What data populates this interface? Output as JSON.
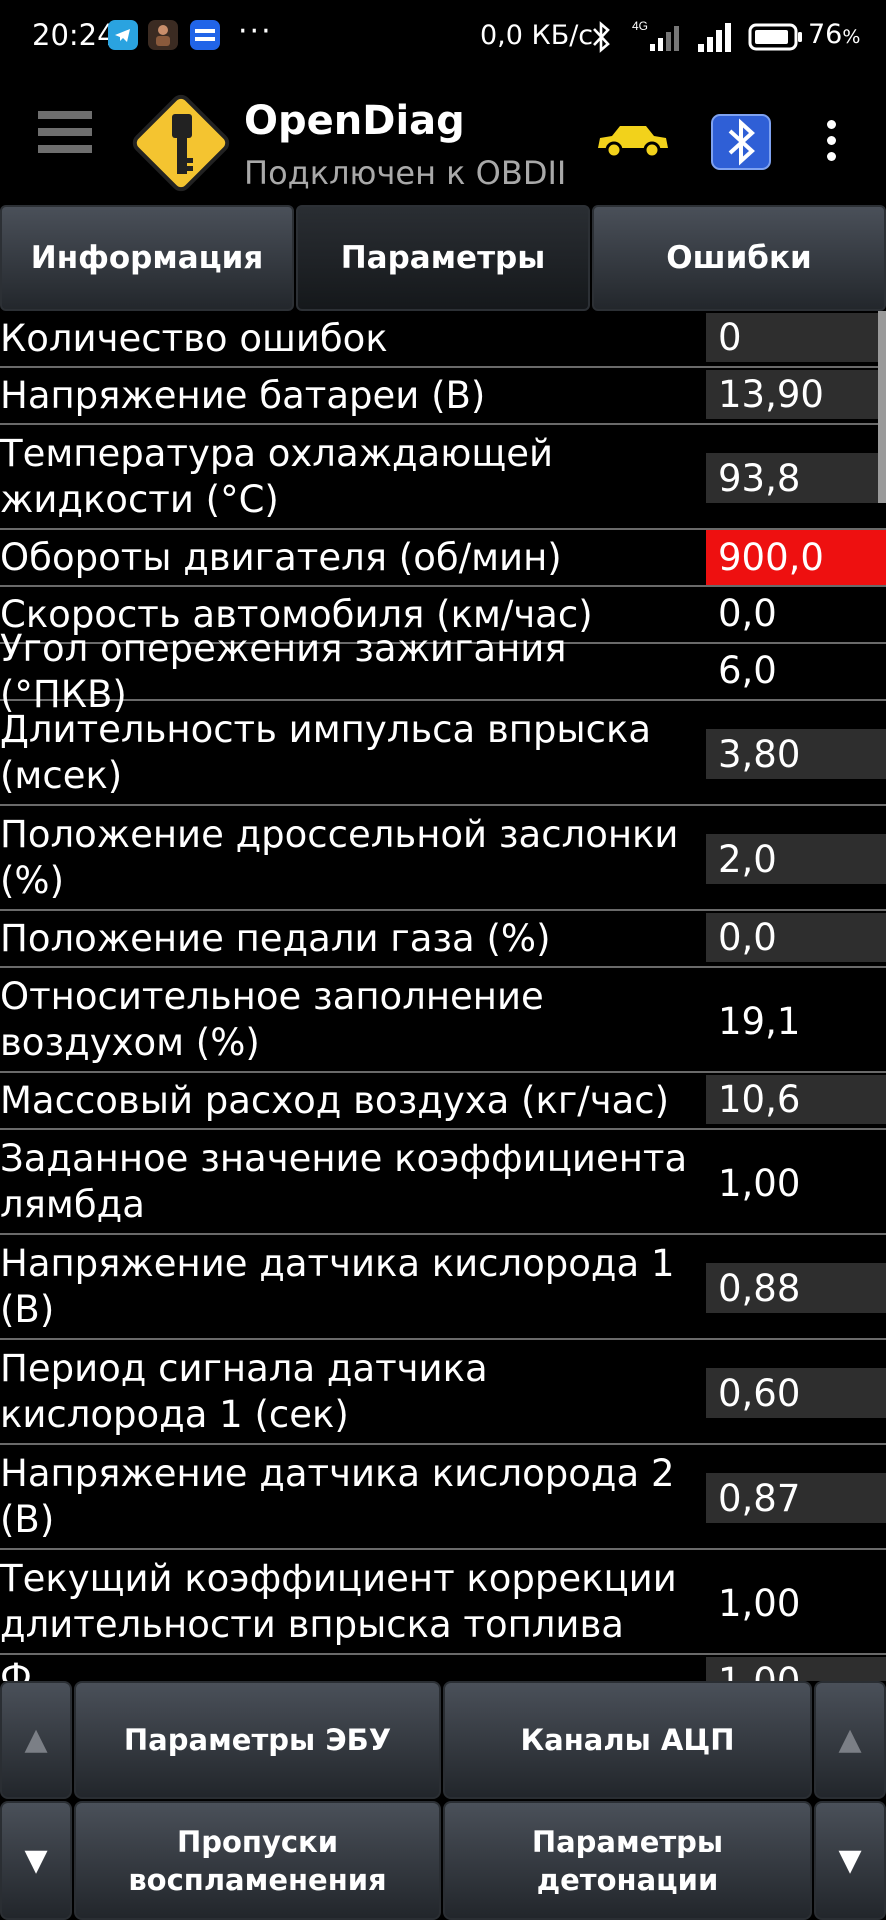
{
  "status_bar": {
    "time": "20:24",
    "dots": "···",
    "network_speed": "0,0 КБ/с",
    "battery_percent": "76",
    "battery_unit": "%"
  },
  "app_bar": {
    "title": "OpenDiag",
    "subtitle": "Подключен к OBDII",
    "car_color": "#f2d21b",
    "bt_color": "#2f5fd6"
  },
  "tabs": [
    {
      "label": "Информация"
    },
    {
      "label": "Параметры"
    },
    {
      "label": "Ошибки"
    }
  ],
  "parameters": [
    {
      "label": "Количество ошибок",
      "value": "0"
    },
    {
      "label": "Напряжение батареи (В)",
      "value": "13,90"
    },
    {
      "label": "Температура охлаждающей жидкости (°С)",
      "value": "93,8"
    },
    {
      "label": "Обороты двигателя (об/мин)",
      "value": "900,0"
    },
    {
      "label": "Скорость автомобиля (км/час)",
      "value": "0,0"
    },
    {
      "label": "Угол опережения зажигания (°ПКВ)",
      "value": "6,0"
    },
    {
      "label": "Длительность импульса впрыска (мсек)",
      "value": "3,80"
    },
    {
      "label": "Положение дроссельной заслонки (%)",
      "value": "2,0"
    },
    {
      "label": "Положение педали газа (%)",
      "value": "0,0"
    },
    {
      "label": "Относительное заполнение воздухом (%)",
      "value": "19,1"
    },
    {
      "label": "Массовый расход воздуха (кг/час)",
      "value": "10,6"
    },
    {
      "label": "Заданное значение коэффициента лямбда",
      "value": "1,00"
    },
    {
      "label": "Напряжение датчика кислорода 1 (В)",
      "value": "0,88"
    },
    {
      "label": "Период сигнала датчика кислорода 1 (сек)",
      "value": "0,60"
    },
    {
      "label": "Напряжение датчика кислорода 2 (В)",
      "value": "0,87"
    },
    {
      "label": "Текущий коэффициент коррекции длительности впрыска топлива",
      "value": "1,00"
    },
    {
      "label": "Ф",
      "value": "1,00"
    }
  ],
  "bottom": {
    "ecu_params": "Параметры ЭБУ",
    "adc_channels": "Каналы АЦП",
    "misfires_line1": "Пропуски",
    "misfires_line2": "воспламенения",
    "knock_line1": "Параметры",
    "knock_line2": "детонации",
    "up_arrow": "▲",
    "down_arrow": "▼"
  },
  "colors": {
    "alarm": "#ee1010",
    "value_box": "#2e2e2e"
  }
}
